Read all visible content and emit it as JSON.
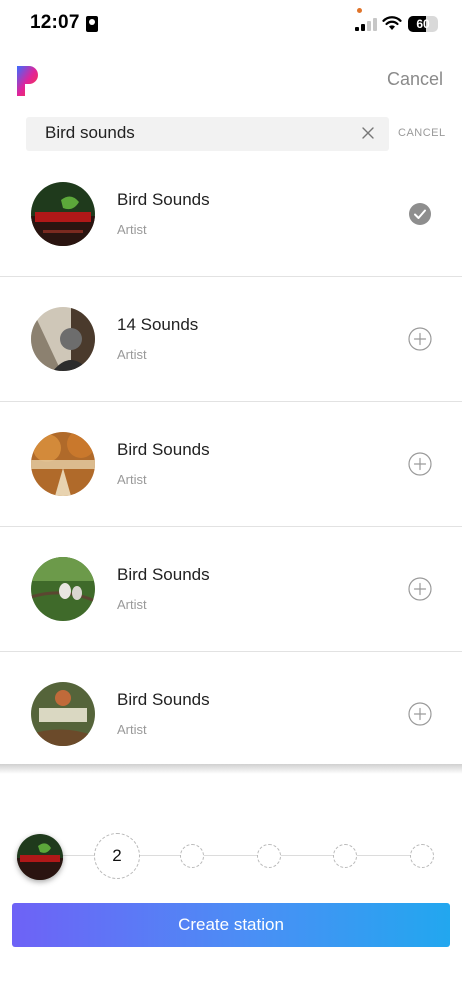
{
  "status_bar": {
    "time": "12:07",
    "battery": "60"
  },
  "header": {
    "cancel_label": "Cancel"
  },
  "search": {
    "query": "Bird sounds",
    "cancel_label": "CANCEL"
  },
  "results": [
    {
      "title": "Bird Sounds",
      "subtitle": "Artist",
      "selected": true
    },
    {
      "title": "14 Sounds",
      "subtitle": "Artist",
      "selected": false
    },
    {
      "title": "Bird Sounds",
      "subtitle": "Artist",
      "selected": false
    },
    {
      "title": "Bird Sounds",
      "subtitle": "Artist",
      "selected": false
    },
    {
      "title": "Bird Sounds",
      "subtitle": "Artist",
      "selected": false
    }
  ],
  "stepper": {
    "next_step": "2"
  },
  "create_button_label": "Create station",
  "colors": {
    "check": "#8e8e8e",
    "button_start": "#6e62f6",
    "button_end": "#22a7ef"
  }
}
